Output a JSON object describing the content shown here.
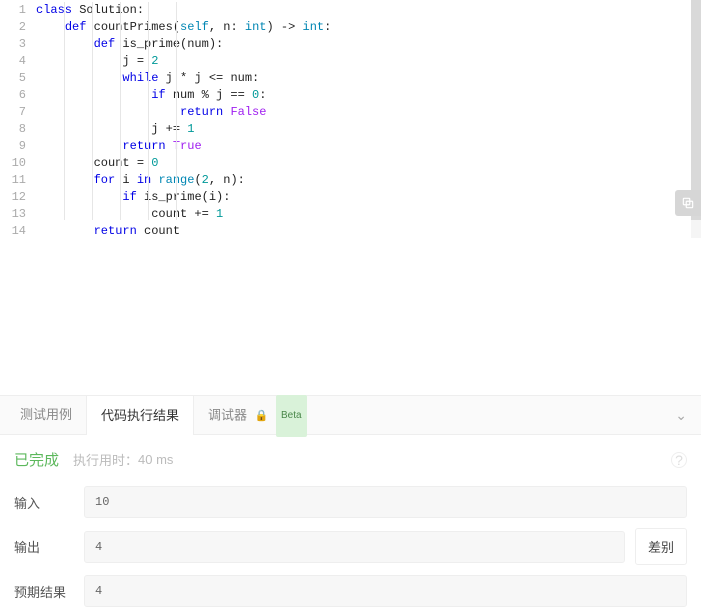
{
  "code": {
    "lines": [
      {
        "n": 1,
        "indent": 0,
        "tokens": [
          [
            "kw",
            "class"
          ],
          [
            "dim",
            " Solution:"
          ]
        ]
      },
      {
        "n": 2,
        "indent": 1,
        "tokens": [
          [
            "kw",
            "def"
          ],
          [
            "dim",
            " countPrimes("
          ],
          [
            "self",
            "self"
          ],
          [
            "dim",
            ", n: "
          ],
          [
            "builtin",
            "int"
          ],
          [
            "dim",
            ") -> "
          ],
          [
            "builtin",
            "int"
          ],
          [
            "dim",
            ":"
          ]
        ]
      },
      {
        "n": 3,
        "indent": 2,
        "tokens": [
          [
            "kw",
            "def"
          ],
          [
            "dim",
            " is_prime(num):"
          ]
        ]
      },
      {
        "n": 4,
        "indent": 3,
        "tokens": [
          [
            "dim",
            "j = "
          ],
          [
            "num",
            "2"
          ]
        ]
      },
      {
        "n": 5,
        "indent": 3,
        "tokens": [
          [
            "kw",
            "while"
          ],
          [
            "dim",
            " j * j <= num:"
          ]
        ]
      },
      {
        "n": 6,
        "indent": 4,
        "tokens": [
          [
            "kw",
            "if"
          ],
          [
            "dim",
            " num % j == "
          ],
          [
            "num",
            "0"
          ],
          [
            "dim",
            ":"
          ]
        ]
      },
      {
        "n": 7,
        "indent": 5,
        "tokens": [
          [
            "kw",
            "return"
          ],
          [
            "dim",
            " "
          ],
          [
            "bool",
            "False"
          ]
        ]
      },
      {
        "n": 8,
        "indent": 4,
        "tokens": [
          [
            "dim",
            "j += "
          ],
          [
            "num",
            "1"
          ]
        ]
      },
      {
        "n": 9,
        "indent": 3,
        "tokens": [
          [
            "kw",
            "return"
          ],
          [
            "dim",
            " "
          ],
          [
            "bool",
            "True"
          ]
        ]
      },
      {
        "n": 10,
        "indent": 2,
        "tokens": [
          [
            "dim",
            "count = "
          ],
          [
            "num",
            "0"
          ]
        ]
      },
      {
        "n": 11,
        "indent": 2,
        "tokens": [
          [
            "kw",
            "for"
          ],
          [
            "dim",
            " i "
          ],
          [
            "kw",
            "in"
          ],
          [
            "dim",
            " "
          ],
          [
            "builtin",
            "range"
          ],
          [
            "dim",
            "("
          ],
          [
            "num",
            "2"
          ],
          [
            "dim",
            ", n):"
          ]
        ]
      },
      {
        "n": 12,
        "indent": 3,
        "tokens": [
          [
            "kw",
            "if"
          ],
          [
            "dim",
            " is_prime(i):"
          ]
        ]
      },
      {
        "n": 13,
        "indent": 4,
        "tokens": [
          [
            "dim",
            "count += "
          ],
          [
            "num",
            "1"
          ]
        ]
      },
      {
        "n": 14,
        "indent": 2,
        "tokens": [
          [
            "kw",
            "return"
          ],
          [
            "dim",
            " count"
          ]
        ]
      }
    ],
    "current_line": 14
  },
  "tabs": {
    "testcase": "测试用例",
    "result": "代码执行结果",
    "debugger": "调试器",
    "beta": "Beta"
  },
  "result": {
    "status": "已完成",
    "runtime_label": "执行用时：",
    "runtime_value": "40 ms",
    "input_label": "输入",
    "input_value": "10",
    "output_label": "输出",
    "output_value": "4",
    "expected_label": "预期结果",
    "expected_value": "4",
    "diff_button": "差别"
  }
}
